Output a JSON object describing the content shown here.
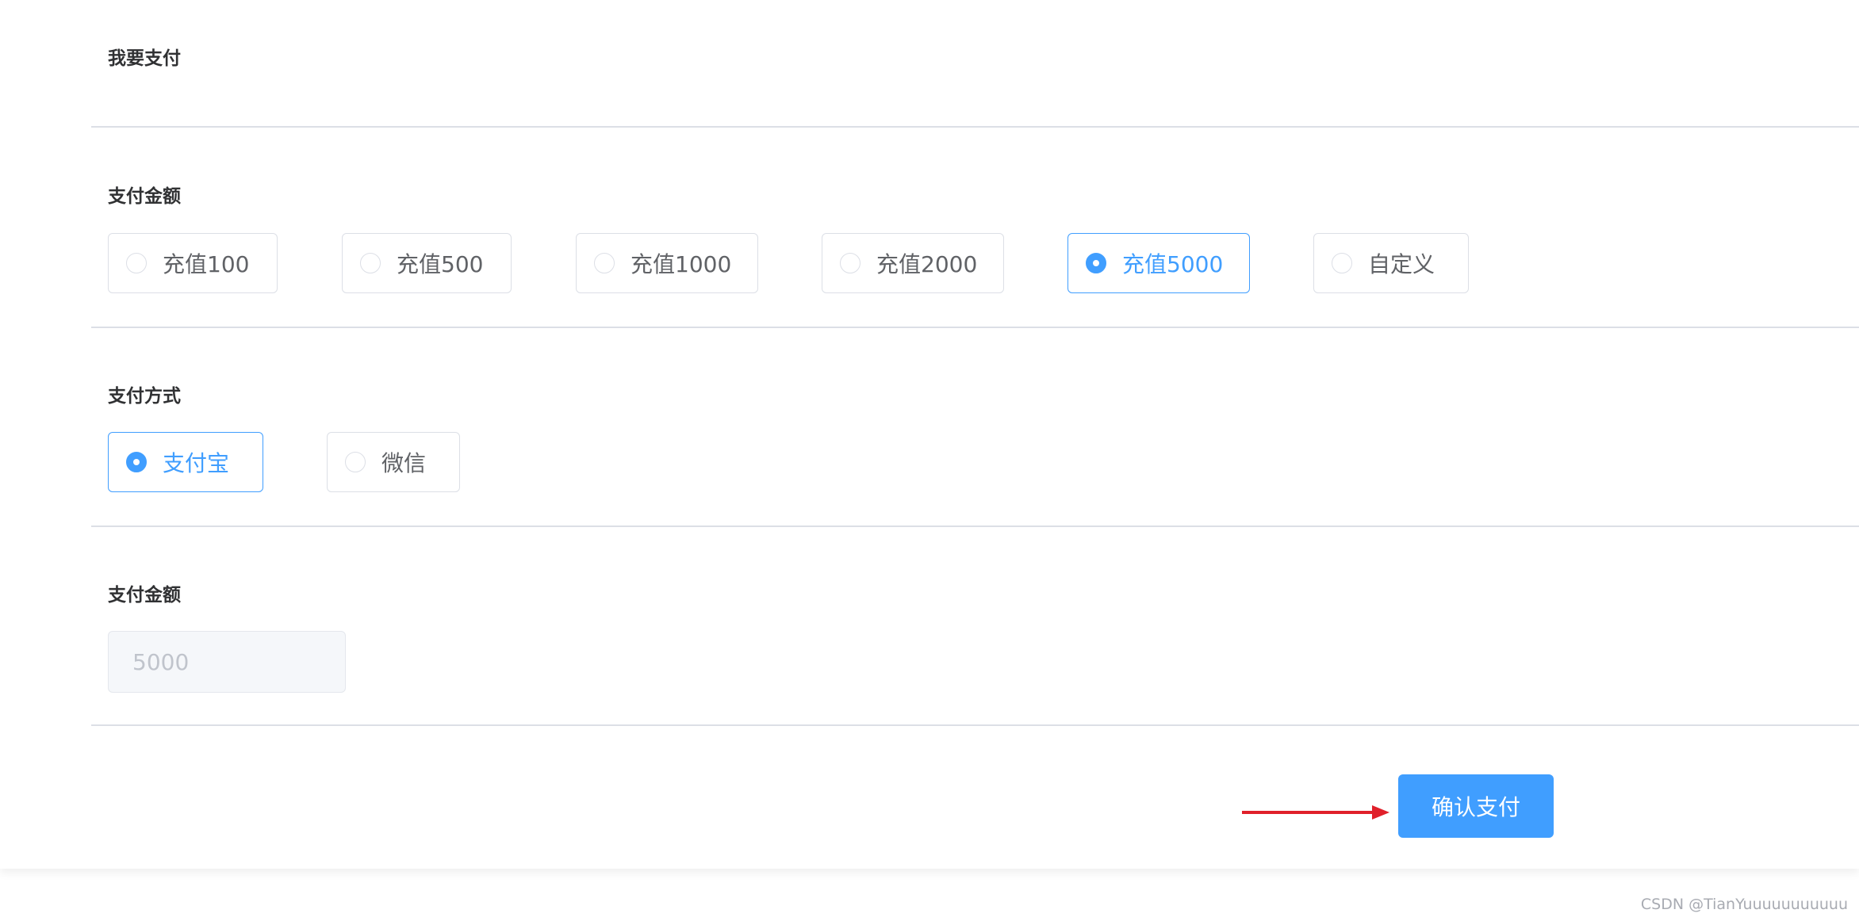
{
  "page_title": "我要支付",
  "amount_section": {
    "label": "支付金额",
    "options": [
      {
        "label": "充值100",
        "checked": false
      },
      {
        "label": "充值500",
        "checked": false
      },
      {
        "label": "充值1000",
        "checked": false
      },
      {
        "label": "充值2000",
        "checked": false
      },
      {
        "label": "充值5000",
        "checked": true
      },
      {
        "label": "自定义",
        "checked": false
      }
    ]
  },
  "method_section": {
    "label": "支付方式",
    "options": [
      {
        "label": "支付宝",
        "checked": true
      },
      {
        "label": "微信",
        "checked": false
      }
    ]
  },
  "total_section": {
    "label": "支付金额",
    "value": "5000"
  },
  "confirm_button": {
    "label": "确认支付"
  },
  "watermark": "CSDN @TianYuuuuuuuuuuu",
  "colors": {
    "primary": "#409eff",
    "border": "#dcdfe6",
    "annotation_arrow": "#e0202a"
  }
}
